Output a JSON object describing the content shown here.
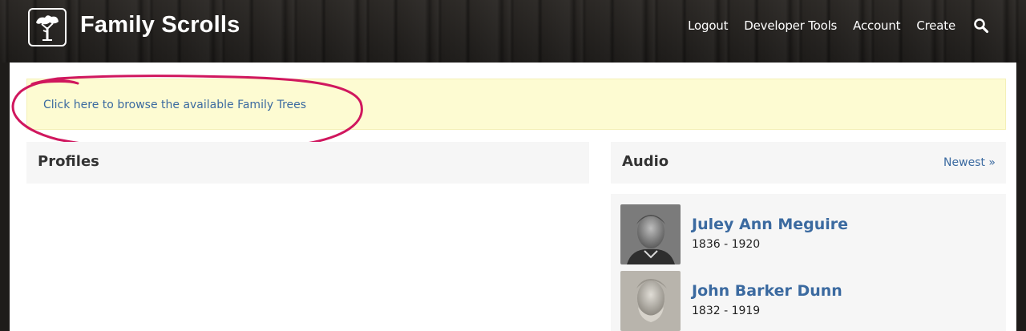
{
  "header": {
    "brand": "Family Scrolls",
    "logo_icon": "tree-icon",
    "nav": [
      {
        "label": "Logout"
      },
      {
        "label": "Developer Tools"
      },
      {
        "label": "Account"
      },
      {
        "label": "Create"
      }
    ],
    "search_icon": "search-icon"
  },
  "notice": {
    "link_text": "Click here to browse the available Family Trees",
    "annotation_color": "#d0175e"
  },
  "profiles": {
    "title": "Profiles"
  },
  "audio": {
    "title": "Audio",
    "newest_link": "Newest »",
    "items": [
      {
        "name": "Juley Ann Meguire",
        "dates": "1836 - 1920"
      },
      {
        "name": "John Barker Dunn",
        "dates": "1832 - 1919"
      }
    ]
  },
  "colors": {
    "link": "#3b6aa0",
    "notice_bg": "#fdfbd2",
    "panel_bg": "#f6f6f6",
    "header_bg": "#25221f"
  }
}
